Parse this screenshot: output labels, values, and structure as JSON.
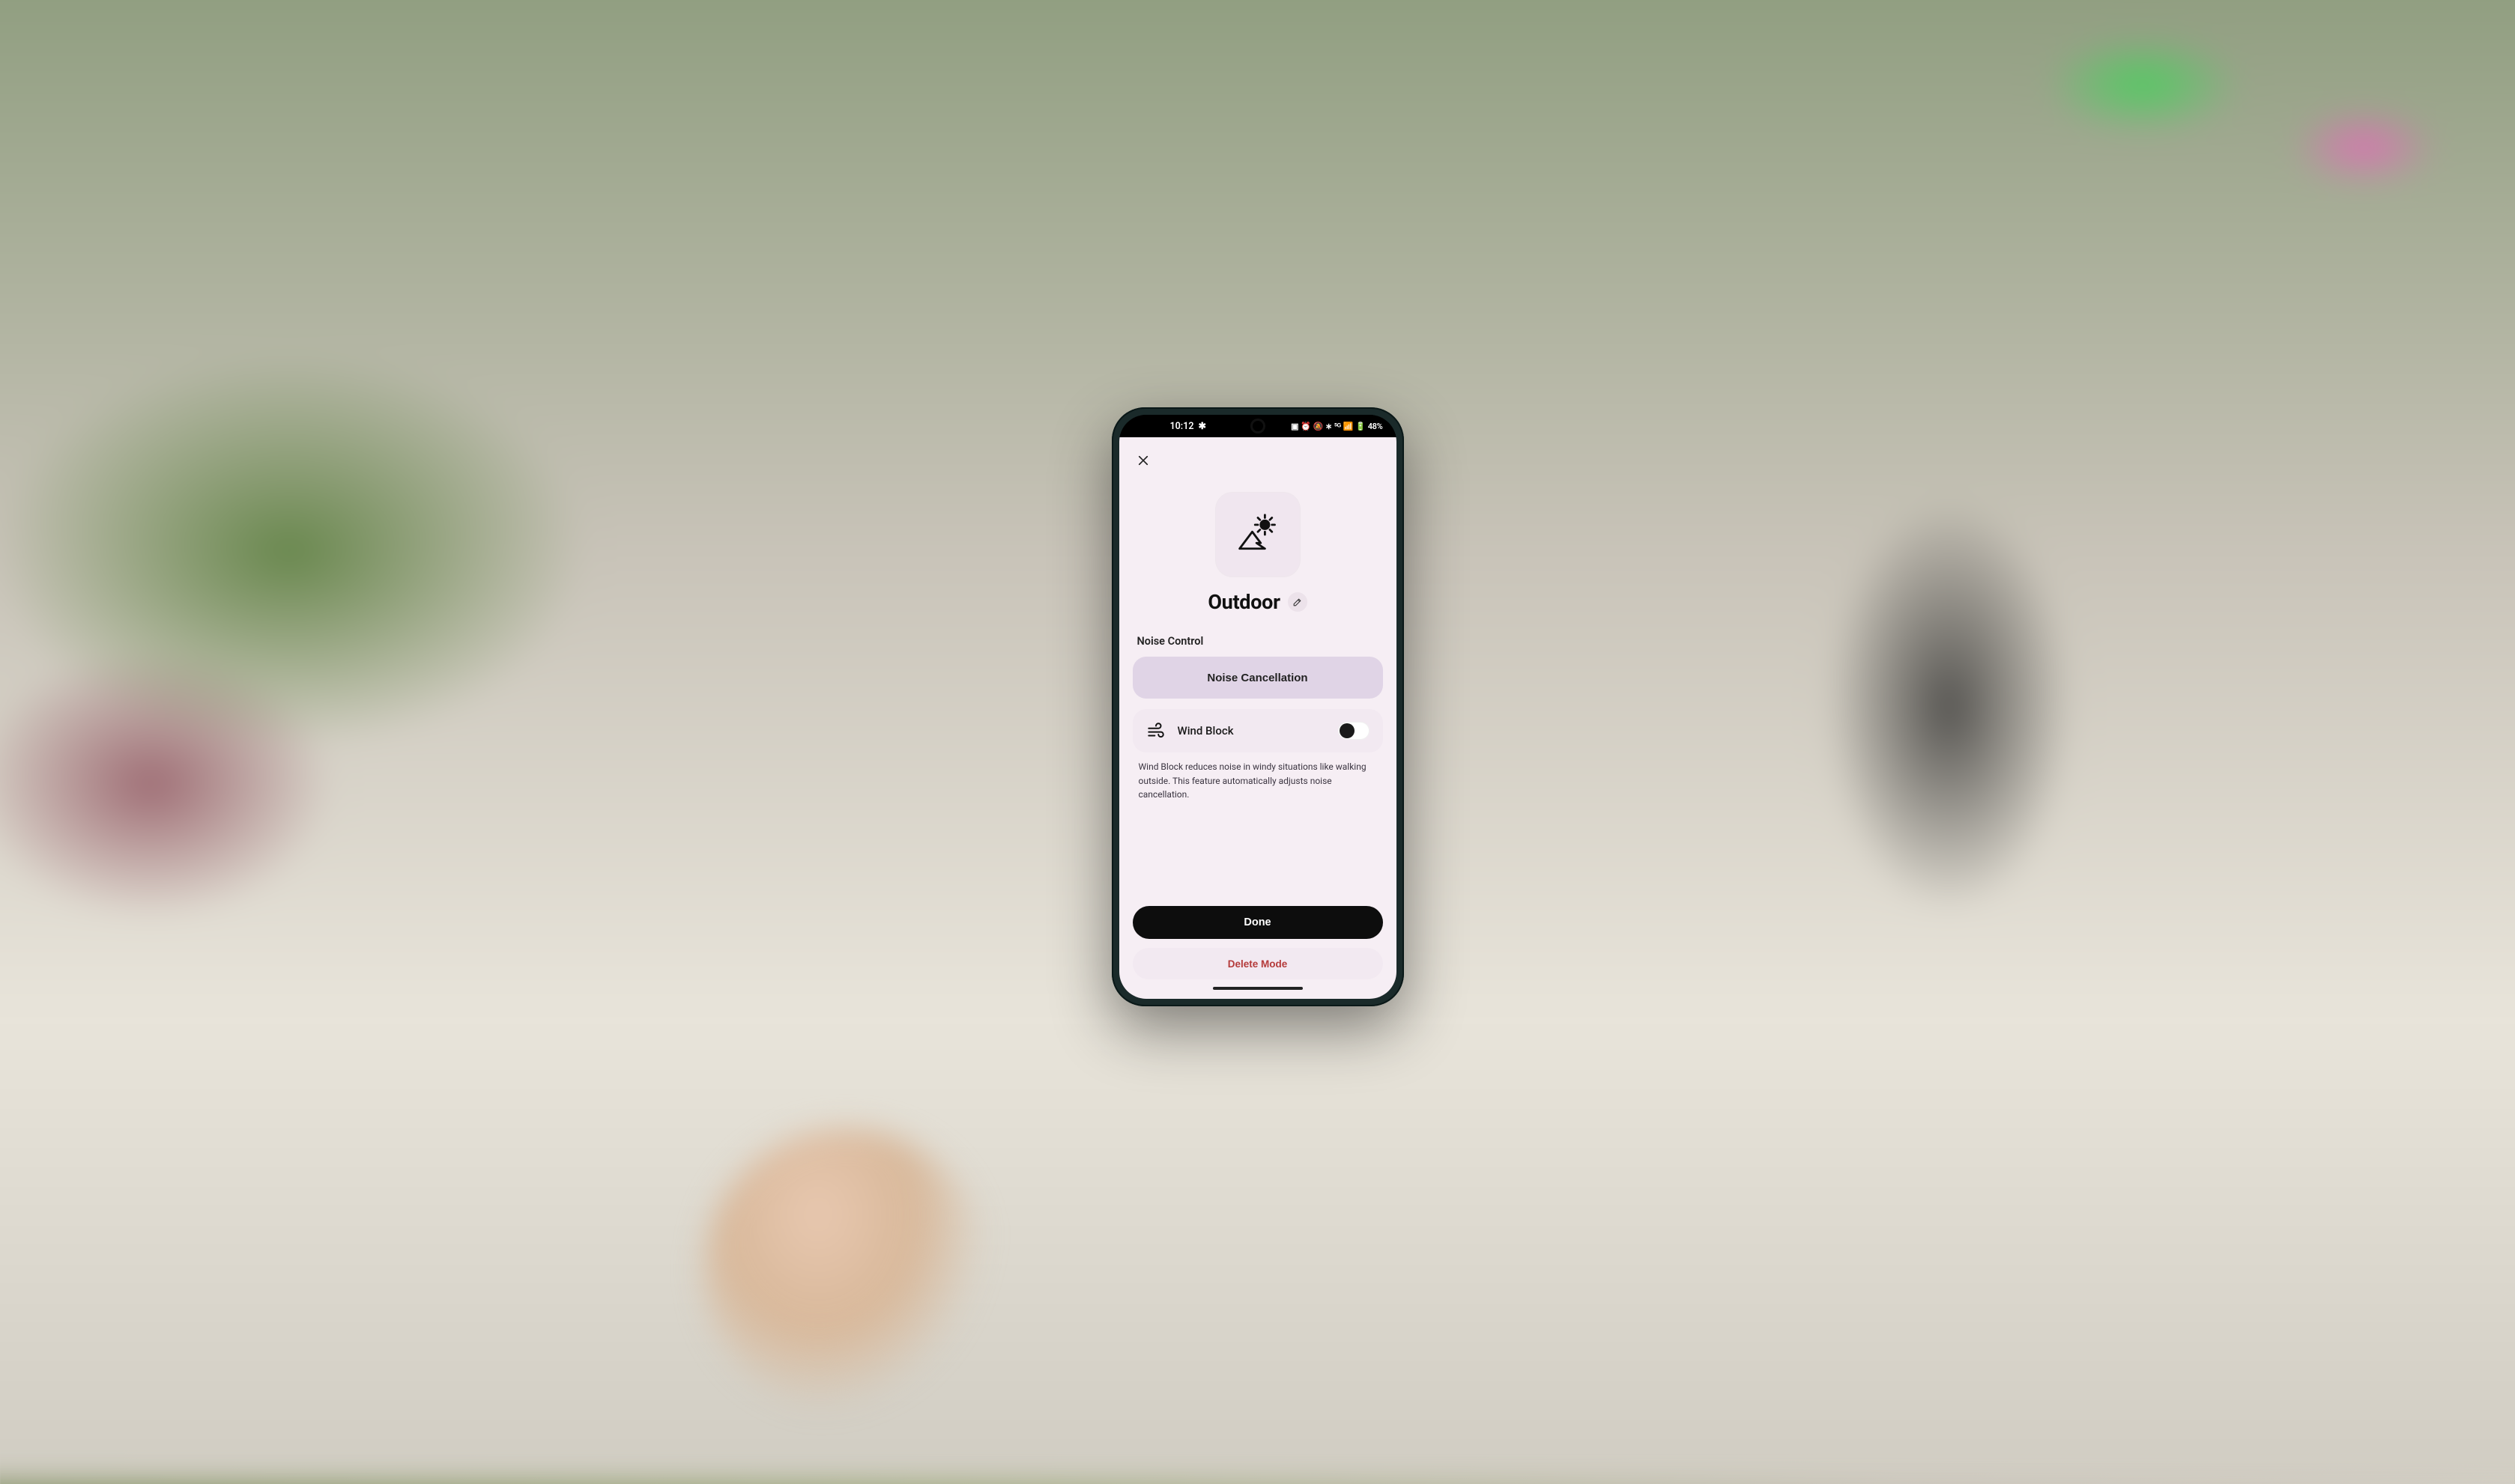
{
  "status_bar": {
    "time": "10:12",
    "battery_text": "48%",
    "indicators": "⏻ ⏰ 🔕 ✱ ⁵ᴳ 📶"
  },
  "header": {
    "close_icon": "close"
  },
  "mode": {
    "title": "Outdoor",
    "icon_name": "outdoor-mountain-sun-icon"
  },
  "noise_control": {
    "section_label": "Noise Control",
    "button_label": "Noise Cancellation"
  },
  "wind_block": {
    "label": "Wind Block",
    "enabled": true,
    "help": "Wind Block reduces noise in windy situations like walking outside. This feature automatically adjusts noise cancellation."
  },
  "actions": {
    "done_label": "Done",
    "delete_label": "Delete Mode"
  }
}
